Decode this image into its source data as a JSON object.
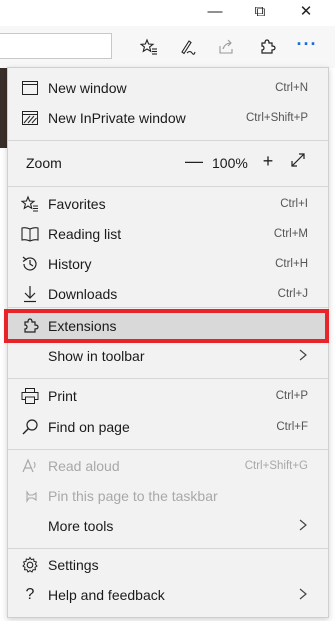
{
  "window_controls": {
    "minimize": "—",
    "restore": "⧉",
    "close": "✕"
  },
  "toolbar": {
    "more_label": "···"
  },
  "menu": {
    "new_window": {
      "label": "New window",
      "shortcut": "Ctrl+N"
    },
    "new_inprivate": {
      "label": "New InPrivate window",
      "shortcut": "Ctrl+Shift+P"
    },
    "zoom": {
      "label": "Zoom",
      "minus": "—",
      "value": "100%",
      "plus": "+"
    },
    "favorites": {
      "label": "Favorites",
      "shortcut": "Ctrl+I"
    },
    "reading_list": {
      "label": "Reading list",
      "shortcut": "Ctrl+M"
    },
    "history": {
      "label": "History",
      "shortcut": "Ctrl+H"
    },
    "downloads": {
      "label": "Downloads",
      "shortcut": "Ctrl+J"
    },
    "extensions": {
      "label": "Extensions"
    },
    "show_in_toolbar": {
      "label": "Show in toolbar"
    },
    "print": {
      "label": "Print",
      "shortcut": "Ctrl+P"
    },
    "find_on_page": {
      "label": "Find on page",
      "shortcut": "Ctrl+F"
    },
    "read_aloud": {
      "label": "Read aloud",
      "shortcut": "Ctrl+Shift+G"
    },
    "pin_taskbar": {
      "label": "Pin this page to the taskbar"
    },
    "more_tools": {
      "label": "More tools"
    },
    "settings": {
      "label": "Settings"
    },
    "help_feedback": {
      "label": "Help and feedback"
    }
  },
  "colors": {
    "accent": "#1a6cd6",
    "highlight_border": "#e8232a",
    "menu_bg": "#f2f2f2",
    "hover_bg": "#d9d9d9"
  }
}
